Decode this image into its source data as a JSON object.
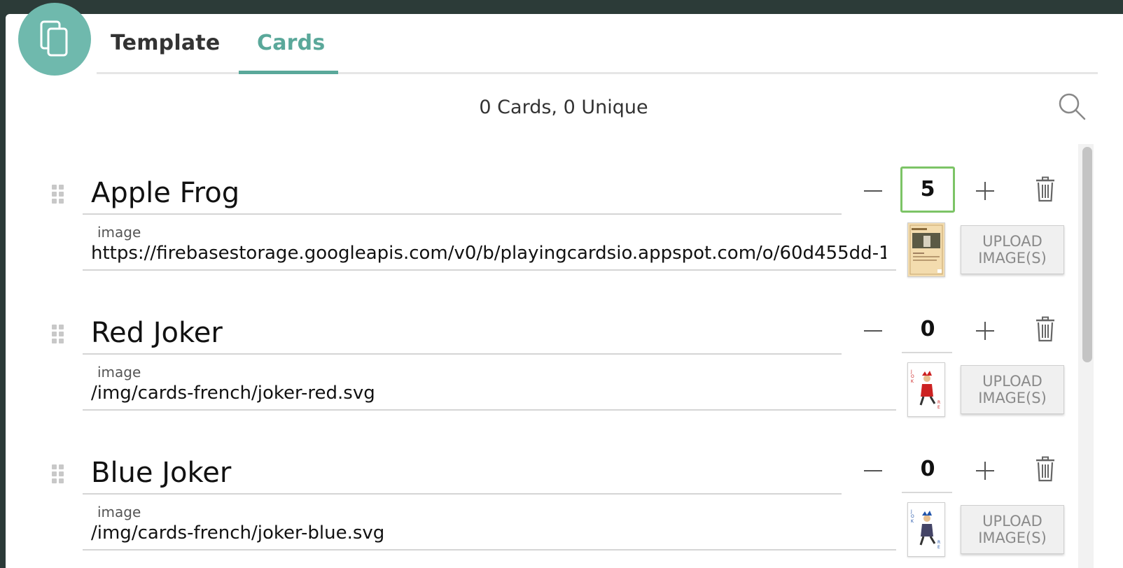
{
  "tabs": {
    "template_label": "Template",
    "cards_label": "Cards"
  },
  "summary": "0 Cards, 0 Unique",
  "colors": {
    "accent": "#5aa89a",
    "icon_circle": "#6fb9ad",
    "focus_ring": "#7cc466"
  },
  "cards": [
    {
      "name": "Apple Frog",
      "count": "5",
      "field_label": "image",
      "image_url": "https://firebasestorage.googleapis.com/v0/b/playingcardsio.appspot.com/o/60d455dd-14a3-",
      "upload_label": "UPLOAD IMAGE(S)"
    },
    {
      "name": "Red Joker",
      "count": "0",
      "field_label": "image",
      "image_url": "/img/cards-french/joker-red.svg",
      "upload_label": "UPLOAD IMAGE(S)"
    },
    {
      "name": "Blue Joker",
      "count": "0",
      "field_label": "image",
      "image_url": "/img/cards-french/joker-blue.svg",
      "upload_label": "UPLOAD IMAGE(S)"
    }
  ],
  "icons": [
    "cards-app-icon",
    "search-icon",
    "drag-handle-icon",
    "minus-icon",
    "plus-icon",
    "trash-icon"
  ]
}
